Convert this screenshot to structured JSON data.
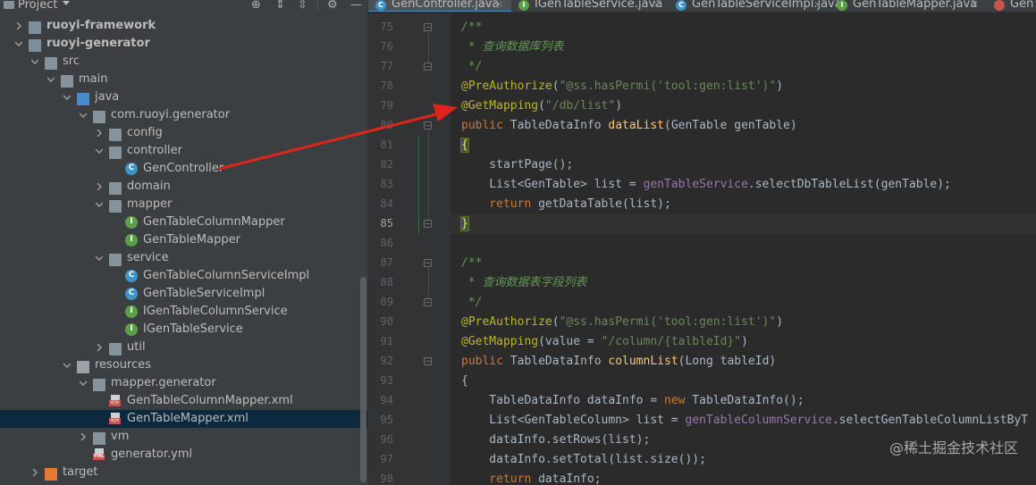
{
  "project_panel": {
    "title": "Project",
    "tree": [
      {
        "label": "ruoyi-framework",
        "icon": "module-folder",
        "bold": true,
        "arrow": "collapsed",
        "depth": 1
      },
      {
        "label": "ruoyi-generator",
        "icon": "module-folder",
        "bold": true,
        "arrow": "expanded",
        "depth": 1
      },
      {
        "label": "src",
        "icon": "folder",
        "arrow": "expanded",
        "depth": 2
      },
      {
        "label": "main",
        "icon": "folder",
        "arrow": "expanded",
        "depth": 3
      },
      {
        "label": "java",
        "icon": "source-folder",
        "arrow": "expanded",
        "depth": 4
      },
      {
        "label": "com.ruoyi.generator",
        "icon": "package",
        "arrow": "expanded",
        "depth": 5
      },
      {
        "label": "config",
        "icon": "package",
        "arrow": "collapsed",
        "depth": 6
      },
      {
        "label": "controller",
        "icon": "package",
        "arrow": "expanded",
        "depth": 6
      },
      {
        "label": "GenController",
        "icon": "class",
        "arrow": "none",
        "depth": 7
      },
      {
        "label": "domain",
        "icon": "package",
        "arrow": "collapsed",
        "depth": 6
      },
      {
        "label": "mapper",
        "icon": "package",
        "arrow": "expanded",
        "depth": 6
      },
      {
        "label": "GenTableColumnMapper",
        "icon": "interface",
        "arrow": "none",
        "depth": 7
      },
      {
        "label": "GenTableMapper",
        "icon": "interface",
        "arrow": "none",
        "depth": 7
      },
      {
        "label": "service",
        "icon": "package",
        "arrow": "expanded",
        "depth": 6
      },
      {
        "label": "GenTableColumnServiceImpl",
        "icon": "class",
        "arrow": "none",
        "depth": 7
      },
      {
        "label": "GenTableServiceImpl",
        "icon": "class",
        "arrow": "none",
        "depth": 7
      },
      {
        "label": "IGenTableColumnService",
        "icon": "interface",
        "arrow": "none",
        "depth": 7
      },
      {
        "label": "IGenTableService",
        "icon": "interface",
        "arrow": "none",
        "depth": 7
      },
      {
        "label": "util",
        "icon": "package",
        "arrow": "collapsed",
        "depth": 6
      },
      {
        "label": "resources",
        "icon": "resources-folder",
        "arrow": "expanded",
        "depth": 4
      },
      {
        "label": "mapper.generator",
        "icon": "folder",
        "arrow": "expanded",
        "depth": 5
      },
      {
        "label": "GenTableColumnMapper.xml",
        "icon": "xml-file",
        "arrow": "none",
        "depth": 6
      },
      {
        "label": "GenTableMapper.xml",
        "icon": "xml-file",
        "arrow": "none",
        "depth": 6,
        "selected": true
      },
      {
        "label": "vm",
        "icon": "folder",
        "arrow": "collapsed",
        "depth": 5
      },
      {
        "label": "generator.yml",
        "icon": "yml-file",
        "arrow": "none",
        "depth": 5
      },
      {
        "label": "target",
        "icon": "excluded-folder",
        "arrow": "collapsed",
        "depth": 2
      }
    ]
  },
  "tabs": [
    {
      "label": "GenController.java",
      "icon": "class",
      "active": true
    },
    {
      "label": "IGenTableService.java",
      "icon": "interface",
      "active": false
    },
    {
      "label": "GenTableServiceImpl.java",
      "icon": "class",
      "active": false
    },
    {
      "label": "GenTableMapper.java",
      "icon": "interface",
      "active": false
    },
    {
      "label": "Gen",
      "icon": "xml-file",
      "active": false
    }
  ],
  "editor": {
    "current_line": 85,
    "lines": [
      {
        "n": 75,
        "tokens": [
          [
            "doc",
            "/**"
          ]
        ]
      },
      {
        "n": 76,
        "tokens": [
          [
            "doc",
            " * 查询数据库列表"
          ]
        ]
      },
      {
        "n": 77,
        "tokens": [
          [
            "doc",
            " */"
          ]
        ]
      },
      {
        "n": 78,
        "tokens": [
          [
            "ann",
            "@PreAuthorize"
          ],
          [
            "plain",
            "("
          ],
          [
            "str",
            "\"@ss.hasPermi('tool:gen:list')\""
          ],
          [
            "plain",
            ")"
          ]
        ]
      },
      {
        "n": 79,
        "tokens": [
          [
            "ann",
            "@GetMapping"
          ],
          [
            "plain",
            "("
          ],
          [
            "str",
            "\"/db/list\""
          ],
          [
            "plain",
            ")"
          ]
        ]
      },
      {
        "n": 80,
        "tokens": [
          [
            "kw",
            "public "
          ],
          [
            "plain",
            "TableDataInfo "
          ],
          [
            "fn",
            "dataList"
          ],
          [
            "plain",
            "(GenTable genTable)"
          ]
        ]
      },
      {
        "n": 81,
        "tokens": [
          [
            "brace",
            "{"
          ]
        ]
      },
      {
        "n": 82,
        "tokens": [
          [
            "plain",
            "    startPage();"
          ]
        ]
      },
      {
        "n": 83,
        "tokens": [
          [
            "plain",
            "    List<GenTable> list = "
          ],
          [
            "fld",
            "genTableService"
          ],
          [
            "plain",
            ".selectDbTableList(genTable);"
          ]
        ]
      },
      {
        "n": 84,
        "tokens": [
          [
            "kw",
            "    return "
          ],
          [
            "plain",
            "getDataTable(list);"
          ]
        ]
      },
      {
        "n": 85,
        "tokens": [
          [
            "brace",
            "}"
          ]
        ]
      },
      {
        "n": 86,
        "tokens": []
      },
      {
        "n": 87,
        "tokens": [
          [
            "doc",
            "/**"
          ]
        ]
      },
      {
        "n": 88,
        "tokens": [
          [
            "doc",
            " * 查询数据表字段列表"
          ]
        ]
      },
      {
        "n": 89,
        "tokens": [
          [
            "doc",
            " */"
          ]
        ]
      },
      {
        "n": 90,
        "tokens": [
          [
            "ann",
            "@PreAuthorize"
          ],
          [
            "plain",
            "("
          ],
          [
            "str",
            "\"@ss.hasPermi('tool:gen:list')\""
          ],
          [
            "plain",
            ")"
          ]
        ]
      },
      {
        "n": 91,
        "tokens": [
          [
            "ann",
            "@GetMapping"
          ],
          [
            "plain",
            "(value = "
          ],
          [
            "str",
            "\"/column/{talbleId}\""
          ],
          [
            "plain",
            ")"
          ]
        ]
      },
      {
        "n": 92,
        "tokens": [
          [
            "kw",
            "public "
          ],
          [
            "plain",
            "TableDataInfo "
          ],
          [
            "fn",
            "columnList"
          ],
          [
            "plain",
            "(Long tableId)"
          ]
        ]
      },
      {
        "n": 93,
        "tokens": [
          [
            "plain",
            "{"
          ]
        ]
      },
      {
        "n": 94,
        "tokens": [
          [
            "plain",
            "    TableDataInfo dataInfo = "
          ],
          [
            "kw",
            "new "
          ],
          [
            "plain",
            "TableDataInfo();"
          ]
        ]
      },
      {
        "n": 95,
        "tokens": [
          [
            "plain",
            "    List<GenTableColumn> list = "
          ],
          [
            "fld",
            "genTableColumnService"
          ],
          [
            "plain",
            ".selectGenTableColumnListByT"
          ]
        ]
      },
      {
        "n": 96,
        "tokens": [
          [
            "plain",
            "    dataInfo.setRows(list);"
          ]
        ]
      },
      {
        "n": 97,
        "tokens": [
          [
            "plain",
            "    dataInfo.setTotal(list.size());"
          ]
        ]
      },
      {
        "n": 98,
        "tokens": [
          [
            "kw",
            "    return "
          ],
          [
            "plain",
            "dataInfo;"
          ]
        ]
      }
    ]
  },
  "watermark": "@稀土掘金技术社区",
  "colors": {
    "accent": "#4a88c7",
    "annotation_arrow": "#e0241b",
    "class_icon": "#3d94c9",
    "interface_icon": "#5aa048",
    "folder": "#87939a",
    "source_folder": "#4d89c9",
    "excluded_folder": "#e37933"
  }
}
